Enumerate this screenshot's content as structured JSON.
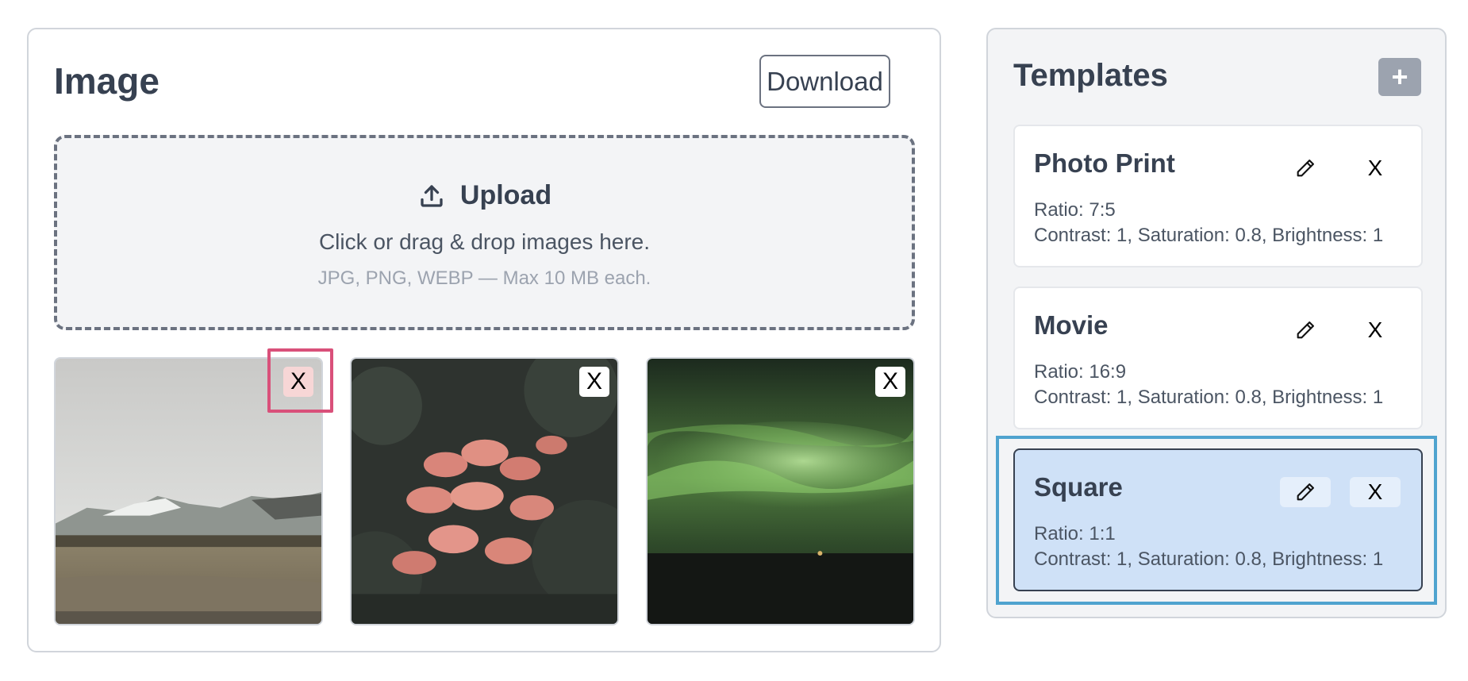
{
  "image_panel": {
    "title": "Image",
    "download_label": "Download",
    "dropzone": {
      "upload_icon": "upload-icon",
      "label": "Upload",
      "hint": "Click or drag & drop images here.",
      "note": "JPG, PNG, WEBP — Max 10 MB each."
    },
    "thumbnails": [
      {
        "subject": "mountain-landscape",
        "remove_label": "X"
      },
      {
        "subject": "flamingos",
        "remove_label": "X"
      },
      {
        "subject": "aurora",
        "remove_label": "X"
      }
    ]
  },
  "templates_panel": {
    "title": "Templates",
    "add_label": "+",
    "templates": [
      {
        "name": "Photo Print",
        "ratio": "Ratio: 7:5",
        "adjustments": "Contrast: 1, Saturation: 0.8, Brightness: 1",
        "delete_label": "X",
        "selected": false
      },
      {
        "name": "Movie",
        "ratio": "Ratio: 16:9",
        "adjustments": "Contrast: 1, Saturation: 0.8, Brightness: 1",
        "delete_label": "X",
        "selected": false
      },
      {
        "name": "Square",
        "ratio": "Ratio: 1:1",
        "adjustments": "Contrast: 1, Saturation: 0.8, Brightness: 1",
        "delete_label": "X",
        "selected": true
      }
    ]
  },
  "colors": {
    "highlight_pink": "#d9507a",
    "selection_blue": "#4fa3cf",
    "selected_card_bg": "#cfe1f7"
  }
}
